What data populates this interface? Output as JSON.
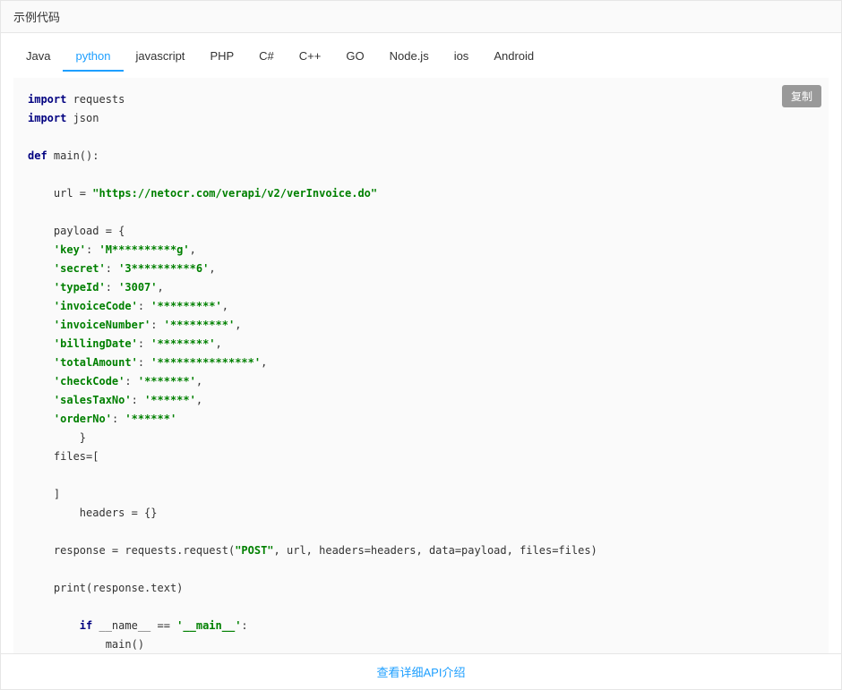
{
  "header": {
    "title": "示例代码"
  },
  "tabs": {
    "items": [
      {
        "label": "Java"
      },
      {
        "label": "python"
      },
      {
        "label": "javascript"
      },
      {
        "label": "PHP"
      },
      {
        "label": "C#"
      },
      {
        "label": "C++"
      },
      {
        "label": "GO"
      },
      {
        "label": "Node.js"
      },
      {
        "label": "ios"
      },
      {
        "label": "Android"
      }
    ],
    "active_index": 1
  },
  "actions": {
    "copy_label": "复制"
  },
  "code": {
    "kw_import": "import",
    "kw_def": "def",
    "kw_if": "if",
    "mod_requests": " requests",
    "mod_json": " json",
    "fn_main": " main():",
    "url_assign": "    url = ",
    "url_value": "\"https://netocr.com/verapi/v2/verInvoice.do\"",
    "payload_open": "    payload = {",
    "p_key_k": "'key'",
    "p_key_v": "'M**********g'",
    "p_secret_k": "'secret'",
    "p_secret_v": "'3**********6'",
    "p_typeid_k": "'typeId'",
    "p_typeid_v": "'3007'",
    "p_invcode_k": "'invoiceCode'",
    "p_invcode_v": "'*********'",
    "p_invnum_k": "'invoiceNumber'",
    "p_invnum_v": "'*********'",
    "p_bill_k": "'billingDate'",
    "p_bill_v": "'********'",
    "p_total_k": "'totalAmount'",
    "p_total_v": "'***************'",
    "p_check_k": "'checkCode'",
    "p_check_v": "'*******'",
    "p_sales_k": "'salesTaxNo'",
    "p_sales_v": "'******'",
    "p_order_k": "'orderNo'",
    "p_order_v": "'******'",
    "brace_close": "        }",
    "files_open": "    files=[",
    "files_close": "    ]",
    "headers_line": "        headers = {}",
    "response_pre": "    response = requests.request(",
    "post_str": "\"POST\"",
    "response_post": ", url, headers=headers, data=payload, files=files)",
    "print_line": "    print(response.text)",
    "if_pre": "        ",
    "if_mid": " __name__ == ",
    "if_main": "'__main__'",
    "if_colon": ":",
    "main_call": "            main()"
  },
  "footer": {
    "link_label": "查看详细API介绍"
  }
}
